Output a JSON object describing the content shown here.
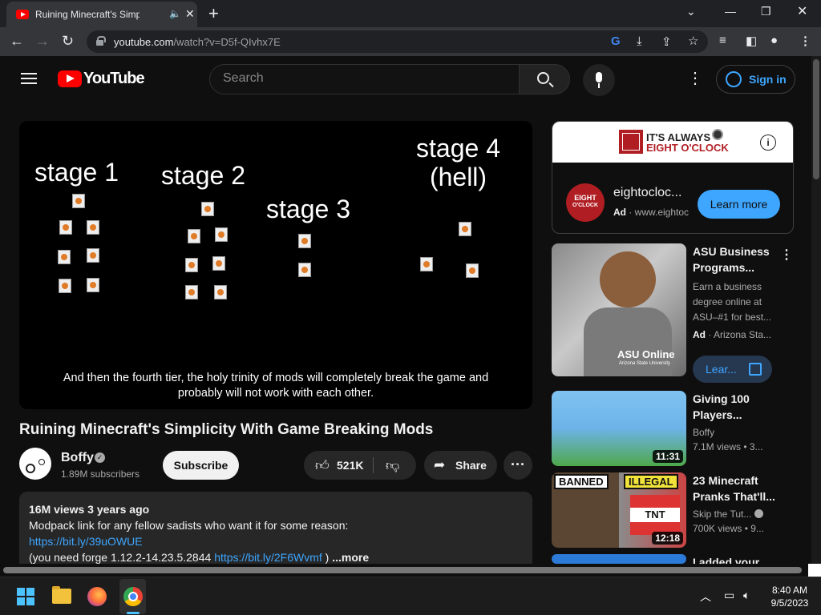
{
  "browser": {
    "tab_title": "Ruining Minecraft's Simplicit",
    "url_host": "youtube.com",
    "url_path": "/watch?v=D5f-QIvhx7E"
  },
  "masthead": {
    "logo_text": "YouTube",
    "search_placeholder": "Search",
    "signin_label": "Sign in"
  },
  "player": {
    "stages": [
      "stage 1",
      "stage 2",
      "stage 3",
      "stage 4\n(hell)"
    ],
    "caption_line1": "And then the fourth tier, the holy trinity of mods will completely break the game and",
    "caption_line2": "probably will not work with each other."
  },
  "video": {
    "title": "Ruining Minecraft's Simplicity With Game Breaking Mods",
    "channel": "Boffy",
    "subscribers": "1.89M subscribers",
    "subscribe_label": "Subscribe",
    "likes": "521K",
    "share_label": "Share",
    "views_date": "16M views  3 years ago",
    "desc_line1": "Modpack link for any fellow sadists who want it for some reason:",
    "desc_link1": "https://bit.ly/39uOWUE",
    "desc_line3_prefix": "(you need forge 1.12.2-14.23.5.2844 ",
    "desc_link2": "https://bit.ly/2F6Wvmf",
    "desc_line3_suffix": " )",
    "more_label": "...more"
  },
  "ad": {
    "banner_line1": "IT'S ALWAYS",
    "banner_line2": "EIGHT O'CLOCK",
    "logo_line1": "EIGHT",
    "logo_line2": "O'CLOCK",
    "name": "eightocloc...",
    "ad_badge": "Ad",
    "domain": "· www.eightoc",
    "cta": "Learn more"
  },
  "recommendations": [
    {
      "title": "ASU Business Programs...",
      "desc": "Earn a business degree online at ASU–#1 for best...",
      "ad_badge": "Ad",
      "advertiser": "· Arizona Sta...",
      "cta": "Lear...",
      "brand": "ASU Online",
      "brand_sub": "Arizona State University"
    },
    {
      "title": "Giving 100 Players...",
      "channel": "Boffy",
      "meta": "7.1M views  • 3...",
      "duration": "11:31"
    },
    {
      "title": "23 Minecraft Pranks That'll...",
      "channel": "Skip the Tut...",
      "meta": "700K views  • 9...",
      "duration": "12:18",
      "badge1": "BANNED",
      "badge2": "ILLEGAL",
      "tnt": "TNT"
    },
    {
      "title": "I added your"
    }
  ],
  "taskbar": {
    "time": "8:40 AM",
    "date": "9/5/2023"
  }
}
